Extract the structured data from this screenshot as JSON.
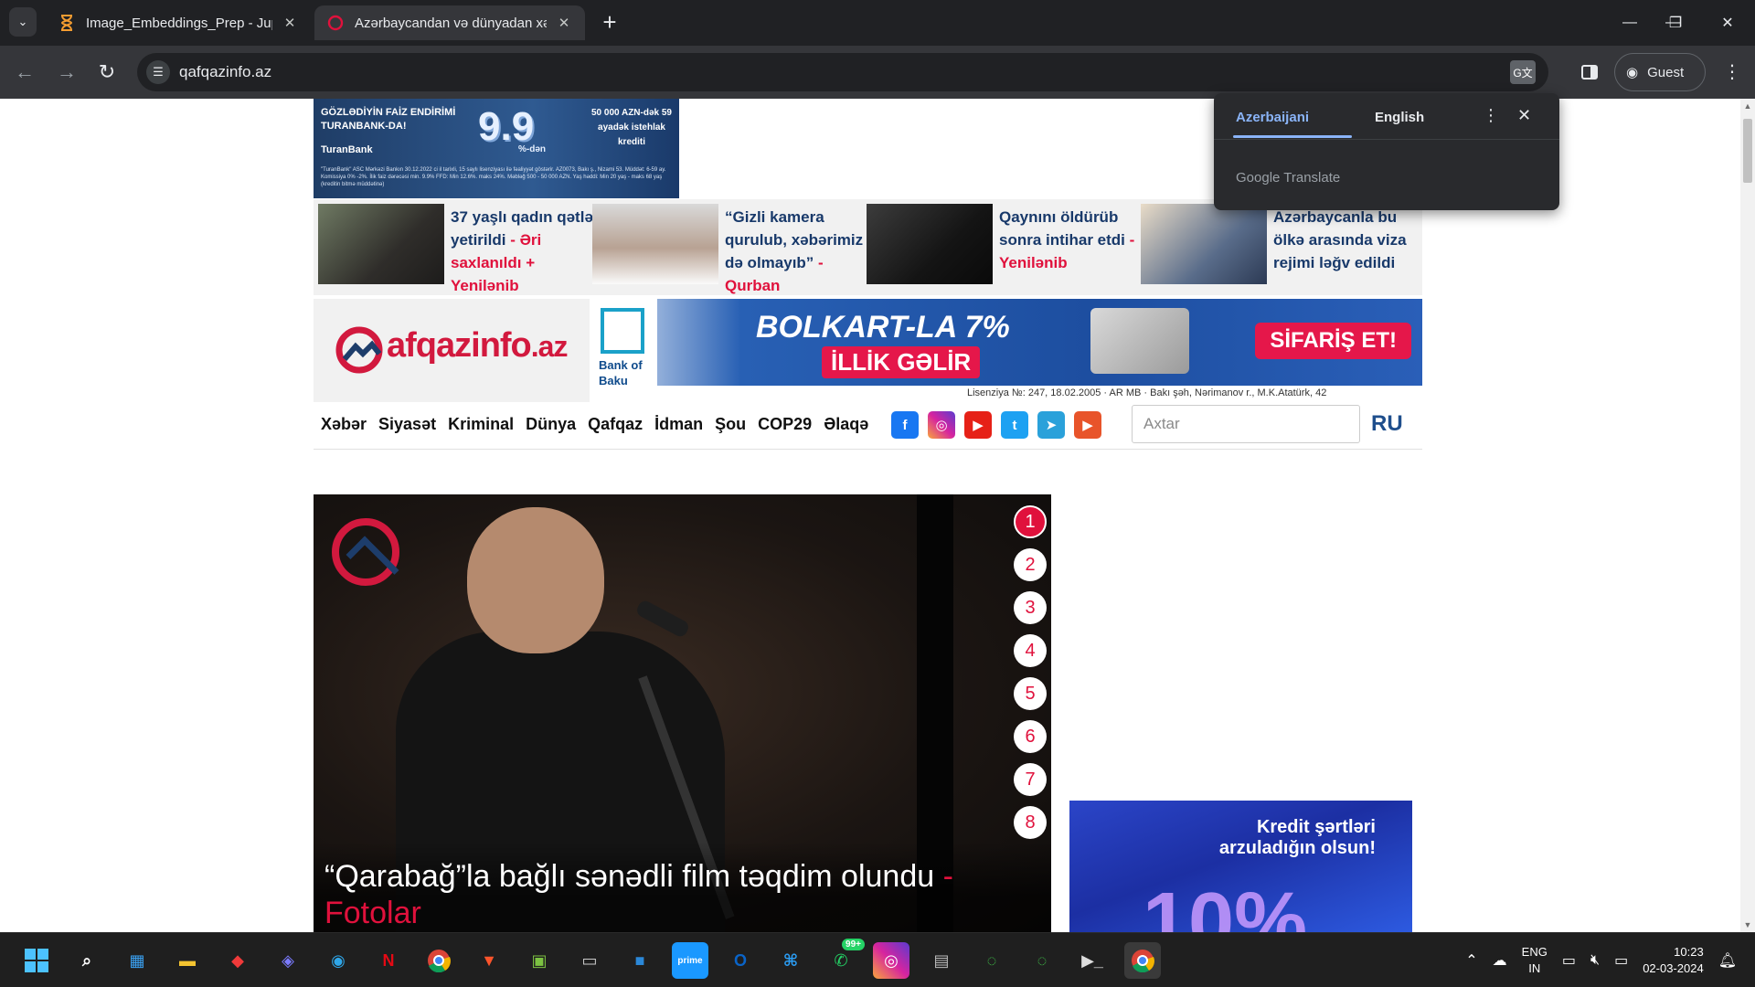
{
  "browser": {
    "tabs": [
      {
        "title": "Image_Embeddings_Prep - Jupy",
        "favicon": "hourglass-icon",
        "active": false
      },
      {
        "title": "Azərbaycandan və dünyadan xə",
        "favicon": "qafqazinfo-icon",
        "active": true
      }
    ],
    "url": "qafqazinfo.az",
    "profile_label": "Guest",
    "window_controls": [
      "minimize",
      "restore",
      "close"
    ]
  },
  "translate_popup": {
    "source_lang": "Azerbaijani",
    "target_lang": "English",
    "brand": "Google Translate"
  },
  "page": {
    "top_ad": {
      "headline": "GÖZLƏDİYİN FAİZ ENDİRİMİ TURANBANK-DA!",
      "bank_name": "TuranBank",
      "rate": "9.9",
      "rate_suffix": "%-dən",
      "right_text": "50 000 AZN-dək 59 ayadək istehlak krediti",
      "fine_print": "\"TuranBank\" ASC Mərkəzi Bankın 30.12.2022 ci il tarixli, 15 saylı lisenziyası ilə fəaliyyət göstərir. AZ0073, Bakı ş., Nizami 53. Müddət: 6-59 ay. Komissiya 0% -2%. İlik faiz dərəcəsi min. 9.9% FFD: Min 12.6%. maks 24%. Məbləğ 500 - 50 000 AZN. Yaş həddi: Min 20 yaş - maks 68 yaş (kreditin bitmə müddətinə)"
    },
    "news_strip": [
      {
        "title": "37 yaşlı qadın qətlə yetirildi",
        "tag": " - Əri saxlanıldı + Yenilənib"
      },
      {
        "title": "“Gizli kamera qurulub, xəbərimiz də olmayıb”",
        "tag": " - Qurban"
      },
      {
        "title": "Qaynını öldürüb sonra intihar etdi",
        "tag": " - Yenilənib"
      },
      {
        "title": "Azərbaycanla bu ölkə arasında viza rejimi ləğv edildi",
        "tag": ""
      }
    ],
    "logo": {
      "name": "Qafqazinfo",
      "text": "afqazinfo",
      "suffix": ".az"
    },
    "bank_ad": {
      "bank_name_line1": "Bank of",
      "bank_name_line2": "Baku",
      "headline": "BOLKART-LA 7%",
      "subline": "İLLİK GƏLİR",
      "cta": "SİFARİŞ ET!"
    },
    "license": "Lisenziya №: 247, 18.02.2005  ·  AR MB  ·  Bakı şəh, Nərimanov r., M.K.Atatürk, 42",
    "nav": {
      "items": [
        "Xəbər",
        "Siyasət",
        "Kriminal",
        "Dünya",
        "Qafqaz",
        "İdman",
        "Şou",
        "COP29",
        "Əlaqə"
      ],
      "socials": [
        {
          "name": "facebook",
          "glyph": "f",
          "color": "#1877f2"
        },
        {
          "name": "instagram",
          "glyph": "◎",
          "color": "#d6249f"
        },
        {
          "name": "youtube",
          "glyph": "▶",
          "color": "#e62117"
        },
        {
          "name": "twitter",
          "glyph": "t",
          "color": "#1da1f2"
        },
        {
          "name": "telegram",
          "glyph": "➤",
          "color": "#2aa1da"
        },
        {
          "name": "video",
          "glyph": "▶",
          "color": "#e8542a"
        }
      ],
      "search_placeholder": "Axtar",
      "lang_switch": "RU"
    },
    "slider": {
      "caption": "“Qarabağ”la bağlı sənədli film təqdim olundu",
      "caption_tag": " - Fotolar",
      "slides": [
        "1",
        "2",
        "3",
        "4",
        "5",
        "6",
        "7",
        "8"
      ],
      "active_slide": "1"
    },
    "right_ad": {
      "line1": "Kredit şərtləri",
      "line2": "arzuladığın olsun!",
      "big": "10%"
    }
  },
  "taskbar": {
    "apps": [
      "start",
      "search",
      "store",
      "file-explorer",
      "app-red",
      "copilot",
      "edge",
      "netflix",
      "chrome-1",
      "brave",
      "app-green",
      "terminal-dark",
      "app-blue",
      "prime-video",
      "outlook",
      "vscode",
      "whatsapp",
      "instagram",
      "app-window",
      "app-ring-1",
      "app-ring-2",
      "terminal",
      "chrome-active"
    ],
    "whatsapp_badge": "99+",
    "tray_lang_line1": "ENG",
    "tray_lang_line2": "IN",
    "time": "10:23",
    "date": "02-03-2024"
  }
}
